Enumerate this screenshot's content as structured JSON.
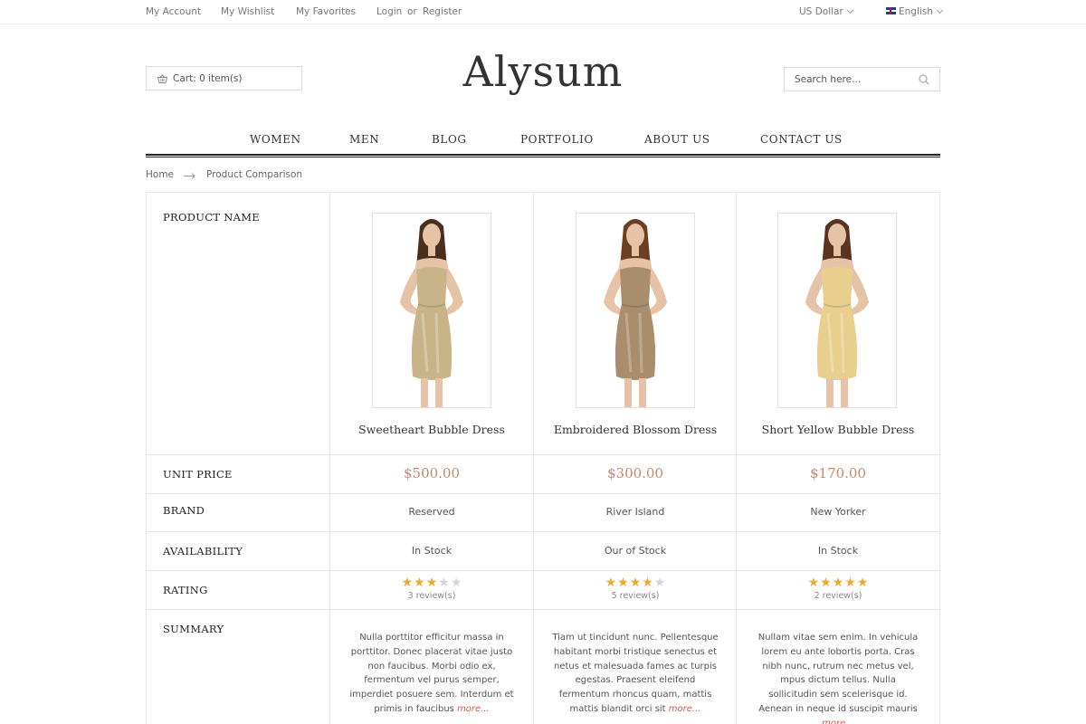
{
  "topbar": {
    "my_account": "My Account",
    "my_wishlist": "My Wishlist",
    "my_favorites": "My Favorites",
    "login": "Login",
    "or": "or",
    "register": "Register",
    "currency": "US Dollar",
    "language": "English"
  },
  "header": {
    "cart_label": "Cart: 0 item(s)",
    "logo": "Alysum",
    "search_placeholder": "Search here..."
  },
  "nav": [
    "WOMEN",
    "MEN",
    "BLOG",
    "PORTFOLIO",
    "ABOUT US",
    "CONTACT US"
  ],
  "breadcrumb": {
    "home": "Home",
    "current": "Product Comparison"
  },
  "table": {
    "labels": {
      "product_name": "PRODUCT NAME",
      "unit_price": "UNIT PRICE",
      "brand": "BRAND",
      "availability": "AVAILABILITY",
      "rating": "RATING",
      "summary": "SUMMARY"
    },
    "more_label": "more...",
    "products": [
      {
        "name": "Sweetheart Bubble Dress",
        "price": "$500.00",
        "brand": "Reserved",
        "availability": "In Stock",
        "rating": 3,
        "reviews": "3 review(s)",
        "summary": "Nulla porttitor efficitur massa in porttitor. Donec placerat vitae justo non faucibus. Morbi odio ex, fermentum vel purus semper, imperdiet posuere sem. Interdum et primis in faucibus",
        "dress_color": "#c9b48a",
        "hair_color": "#4a2e1e"
      },
      {
        "name": "Embroidered Blossom Dress",
        "price": "$300.00",
        "brand": "River Island",
        "availability": "Our of Stock",
        "rating": 4,
        "reviews": "5 review(s)",
        "summary": "Tiam ut tincidunt nunc. Pellentesque habitant morbi tristique senectus et netus et malesuada fames ac turpis egestas. Praesent eleifend fermentum rhoncus quam, mattis mattis blandit orci sit",
        "dress_color": "#a88e6c",
        "hair_color": "#6b3f22"
      },
      {
        "name": "Short Yellow Bubble Dress",
        "price": "$170.00",
        "brand": "New Yorker",
        "availability": "In Stock",
        "rating": 5,
        "reviews": "2 review(s)",
        "summary": "Nullam vitae sem enim. In vehicula lorem eu ante lobortis porta. Cras nibh nunc, rutrum nec metus vel, mpus dictum tellus. Nulla sollicitudin sem scelerisque id. Aenean in neque id suscipit mauris",
        "dress_color": "#e8cf8e",
        "hair_color": "#5a3420"
      }
    ]
  },
  "colors": {
    "price": "#c08a6d",
    "star_on": "#f0a82c",
    "star_off": "#d4d4d4",
    "more_link": "#d9584a"
  }
}
